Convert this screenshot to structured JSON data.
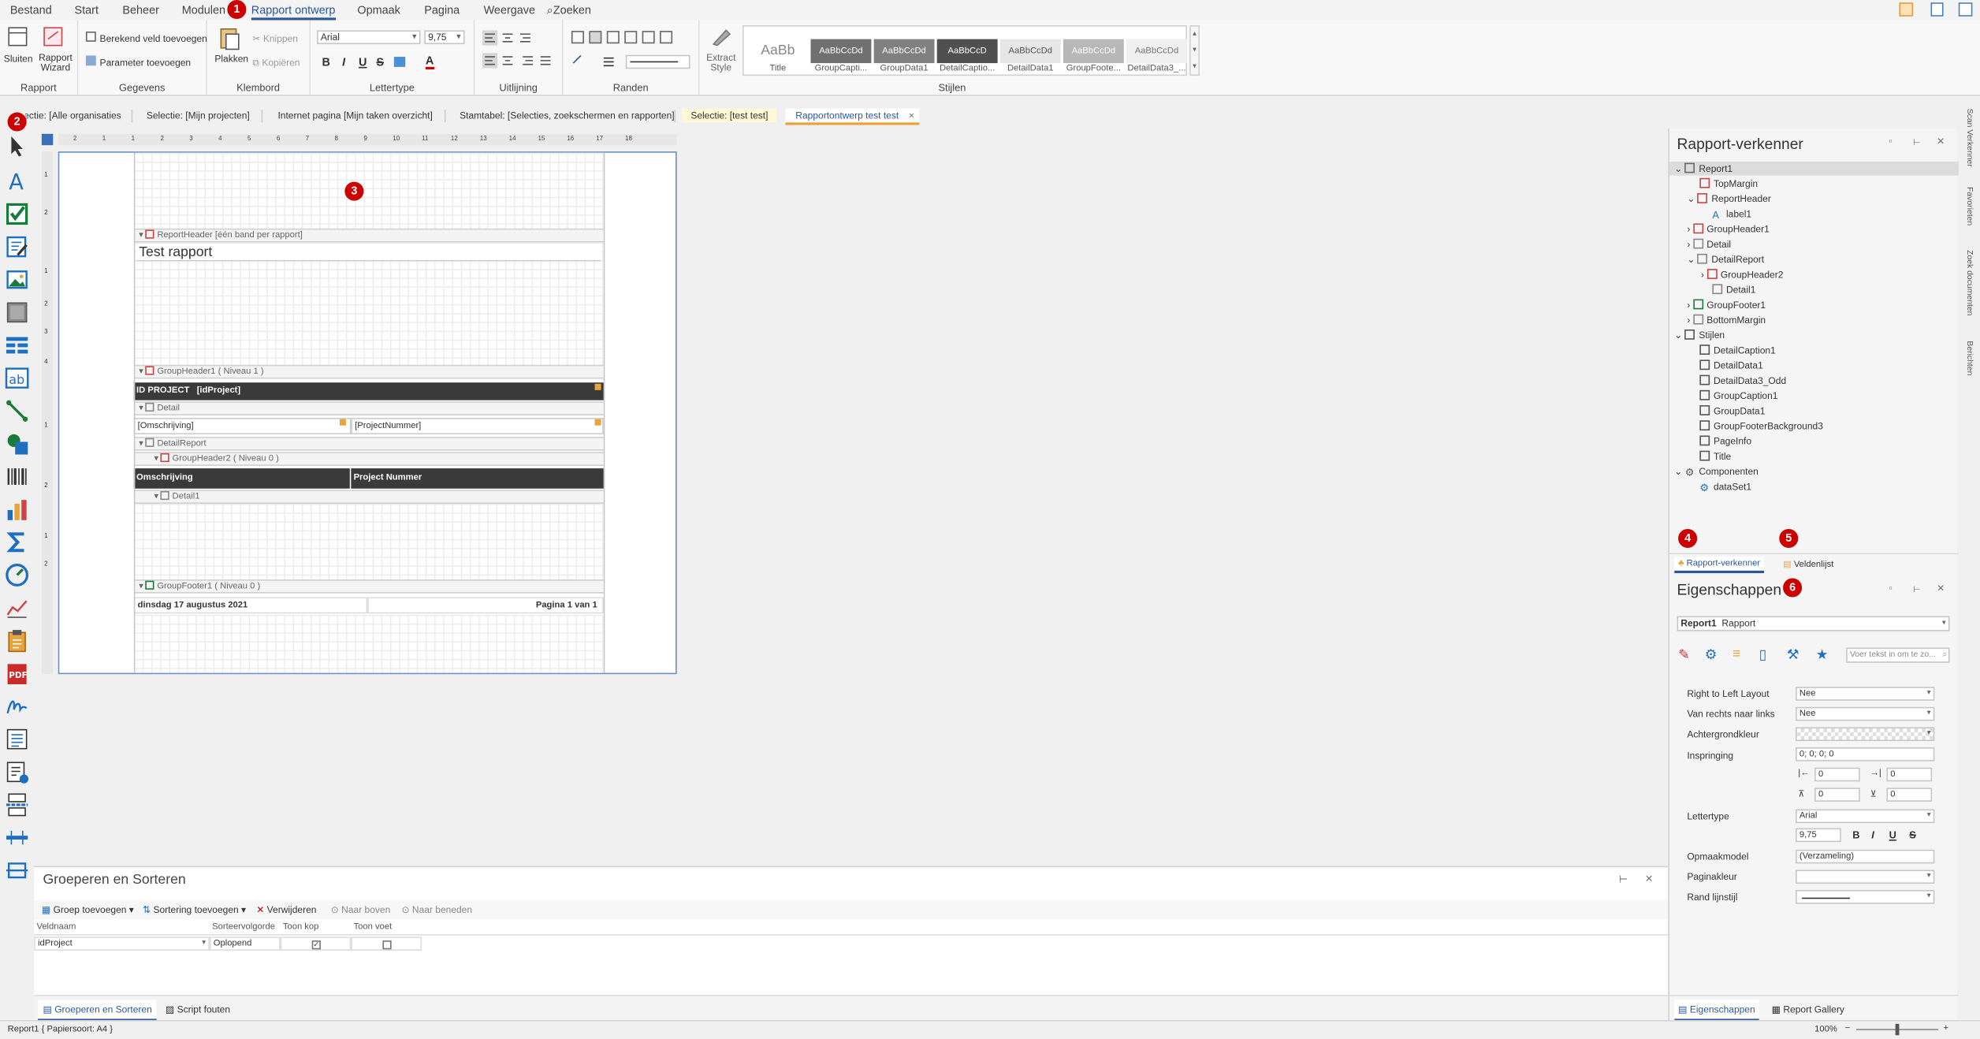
{
  "menu": {
    "items": [
      "Bestand",
      "Start",
      "Beheer",
      "Modulen",
      "Rapport ontwerp",
      "Opmaak",
      "Pagina",
      "Weergave"
    ],
    "search": "Zoeken"
  },
  "annotations": {
    "m1": "1",
    "m2": "2",
    "m3": "3",
    "m4": "4",
    "m5": "5",
    "m6": "6"
  },
  "ribbon": {
    "rapport": {
      "label": "Rapport",
      "close": "Sluiten",
      "wizard": "Rapport Wizard"
    },
    "gegevens": {
      "label": "Gegevens",
      "calc": "Berekend veld toevoegen",
      "param": "Parameter toevoegen"
    },
    "klembord": {
      "label": "Klembord",
      "paste": "Plakken",
      "cut": "Knippen",
      "copy": "Kopiëren"
    },
    "lettertype": {
      "label": "Lettertype",
      "font": "Arial",
      "size": "9,75"
    },
    "uitlijning": {
      "label": "Uitlijning"
    },
    "randen": {
      "label": "Randen"
    },
    "stijlen": {
      "label": "Stijlen",
      "extract": "Extract Style",
      "items": [
        {
          "sample": "AaBb",
          "name": "Title"
        },
        {
          "sample": "AaBbCcDd",
          "name": "GroupCapti..."
        },
        {
          "sample": "AaBbCcDd",
          "name": "GroupData1"
        },
        {
          "sample": "AaBbCcD",
          "name": "DetailCaptio..."
        },
        {
          "sample": "AaBbCcDd",
          "name": "DetailData1"
        },
        {
          "sample": "AaBbCcDd",
          "name": "GroupFoote..."
        },
        {
          "sample": "AaBbCcDd",
          "name": "DetailData3_..."
        }
      ]
    }
  },
  "doc_tabs": [
    "Selectie: [Alle organisaties]",
    "Selectie: [Mijn projecten]",
    "Internet pagina [Mijn taken overzicht]",
    "Stamtabel: [Selecties, zoekschermen en rapporten]",
    "Selectie: [test test]",
    "Rapportontwerp test test"
  ],
  "ruler": [
    "2",
    "1",
    "1",
    "2",
    "3",
    "4",
    "5",
    "6",
    "7",
    "8",
    "9",
    "10",
    "11",
    "12",
    "13",
    "14",
    "15",
    "16",
    "17",
    "18"
  ],
  "vruler": [
    "1",
    "2",
    "1",
    "2",
    "3",
    "4",
    "1",
    "2",
    "1",
    "2"
  ],
  "design": {
    "report_header_band": "ReportHeader [één band per rapport]",
    "label1": "Test rapport",
    "group_header1": "GroupHeader1 ( Niveau 1 )",
    "id_project": "ID PROJECT",
    "id_project_field": "[idProject]",
    "detail": "Detail",
    "omschrijving_field": "[Omschrijving]",
    "projectnummer_field": "[ProjectNummer]",
    "detail_report": "DetailReport",
    "group_header2": "GroupHeader2 ( Niveau 0 )",
    "col_omschrijving": "Omschrijving",
    "col_projectnummer": "Project Nummer",
    "detail1": "Detail1",
    "group_footer1": "GroupFooter1 ( Niveau 0 )",
    "footer_date": "dinsdag 17 augustus 2021",
    "footer_page": "Pagina 1 van 1"
  },
  "groups_panel": {
    "title": "Groeperen en Sorteren",
    "toolbar": {
      "add_group": "Groep toevoegen",
      "add_sort": "Sortering toevoegen",
      "remove": "Verwijderen",
      "up": "Naar boven",
      "down": "Naar beneden"
    },
    "columns": [
      "Veldnaam",
      "Sorteervolgorde",
      "Toon kop",
      "Toon voet"
    ],
    "rows": [
      {
        "field": "idProject",
        "order": "Oplopend",
        "show_header": true,
        "show_footer": false
      }
    ],
    "tabs": [
      "Groeperen en Sorteren",
      "Script fouten"
    ]
  },
  "explorer": {
    "title": "Rapport-verkenner",
    "tree": [
      "Report1",
      "TopMargin",
      "ReportHeader",
      "label1",
      "GroupHeader1",
      "Detail",
      "DetailReport",
      "GroupHeader2",
      "Detail1",
      "GroupFooter1",
      "BottomMargin",
      "Stijlen",
      "DetailCaption1",
      "DetailData1",
      "DetailData3_Odd",
      "GroupCaption1",
      "GroupData1",
      "GroupFooterBackground3",
      "PageInfo",
      "Title",
      "Componenten",
      "dataSet1"
    ],
    "tabs": [
      "Rapport-verkenner",
      "Veldenlijst"
    ]
  },
  "properties": {
    "title": "Eigenschappen",
    "object": "Report1",
    "object_type": "Rapport",
    "search_placeholder": "Voer tekst in om te zo...",
    "rows": [
      {
        "name": "Right to Left Layout",
        "value": "Nee"
      },
      {
        "name": "Van rechts naar links",
        "value": "Nee"
      },
      {
        "name": "Achtergrondkleur",
        "value": ""
      },
      {
        "name": "Inspringing",
        "value": "0; 0; 0; 0"
      },
      {
        "name": "Lettertype",
        "value": "Arial"
      },
      {
        "name": "Opmaakmodel",
        "value": "(Verzameling)"
      },
      {
        "name": "Paginakleur",
        "value": ""
      },
      {
        "name": "Rand lijnstijl",
        "value": ""
      }
    ],
    "padding": [
      "0",
      "0",
      "0",
      "0"
    ],
    "font_size": "9,75",
    "tabs": [
      "Eigenschappen",
      "Report Gallery"
    ]
  },
  "side_tabs": [
    "Scan Verkenner",
    "Favorieten",
    "Zoek documenten",
    "Berichten"
  ],
  "status": {
    "left": "Report1 { Papiersoort: A4 }",
    "zoom": "100%"
  }
}
